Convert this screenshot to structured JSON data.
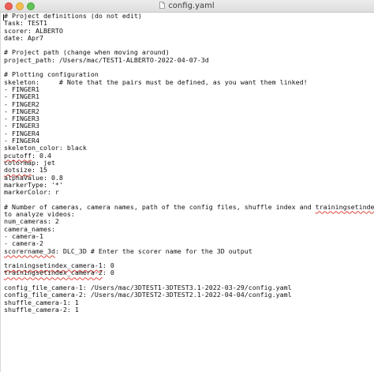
{
  "window": {
    "title": "config.yaml",
    "title_icon": "document-icon"
  },
  "editor": {
    "lines": [
      {
        "segments": [
          {
            "text": "# Project definitions (do not edit)"
          }
        ]
      },
      {
        "segments": [
          {
            "text": "Task: TEST1"
          }
        ]
      },
      {
        "segments": [
          {
            "text": "scorer: ALBERTO"
          }
        ]
      },
      {
        "segments": [
          {
            "text": "date: Apr7"
          }
        ]
      },
      {
        "segments": [
          {
            "text": ""
          }
        ]
      },
      {
        "segments": [
          {
            "text": "# Project path (change when moving around)"
          }
        ]
      },
      {
        "segments": [
          {
            "text": "project_path: /Users/mac/TEST1-ALBERTO-2022-04-07-3d"
          }
        ]
      },
      {
        "segments": [
          {
            "text": ""
          }
        ]
      },
      {
        "segments": [
          {
            "text": "# Plotting configuration"
          }
        ]
      },
      {
        "segments": [
          {
            "text": "skeleton:     # Note that the pairs must be defined, as you want them linked!"
          }
        ]
      },
      {
        "segments": [
          {
            "text": "- FINGER1"
          }
        ]
      },
      {
        "segments": [
          {
            "text": "- FINGER1"
          }
        ]
      },
      {
        "segments": [
          {
            "text": "- FINGER2"
          }
        ]
      },
      {
        "segments": [
          {
            "text": "- FINGER2"
          }
        ]
      },
      {
        "segments": [
          {
            "text": "- FINGER3"
          }
        ]
      },
      {
        "segments": [
          {
            "text": "- FINGER3"
          }
        ]
      },
      {
        "segments": [
          {
            "text": "- FINGER4"
          }
        ]
      },
      {
        "segments": [
          {
            "text": "- FINGER4"
          }
        ]
      },
      {
        "segments": [
          {
            "text": "skeleton_color: black"
          }
        ]
      },
      {
        "segments": [
          {
            "text": "pcutoff",
            "spell": true
          },
          {
            "text": ": 0.4"
          }
        ]
      },
      {
        "segments": [
          {
            "text": "colormap: jet"
          }
        ]
      },
      {
        "segments": [
          {
            "text": "dotsize",
            "spell": true
          },
          {
            "text": ": 15"
          }
        ]
      },
      {
        "segments": [
          {
            "text": "alphaValue: 0.8"
          }
        ]
      },
      {
        "segments": [
          {
            "text": "markerType: '*'"
          }
        ]
      },
      {
        "segments": [
          {
            "text": "markerColor: r"
          }
        ]
      },
      {
        "segments": [
          {
            "text": ""
          }
        ]
      },
      {
        "segments": [
          {
            "text": "# Number of cameras, camera names, path of the config files, shuffle index and "
          },
          {
            "text": "trainingsetindex",
            "spell": true
          },
          {
            "text": " used"
          }
        ]
      },
      {
        "segments": [
          {
            "text": "to analyze videos:"
          }
        ]
      },
      {
        "segments": [
          {
            "text": "num_cameras: 2"
          }
        ]
      },
      {
        "segments": [
          {
            "text": "camera_names:"
          }
        ]
      },
      {
        "segments": [
          {
            "text": "- camera-1"
          }
        ]
      },
      {
        "segments": [
          {
            "text": "- camera-2"
          }
        ]
      },
      {
        "segments": [
          {
            "text": "scorername_3d",
            "spell": true
          },
          {
            "text": ": DLC_3D # Enter the scorer name for the 3D output"
          }
        ]
      },
      {
        "segments": [
          {
            "text": ""
          }
        ]
      },
      {
        "segments": [
          {
            "text": "trainingsetindex_camera-1",
            "spell": true
          },
          {
            "text": ": 0"
          }
        ]
      },
      {
        "segments": [
          {
            "text": "trainingsetindex_camera-2",
            "spell": true
          },
          {
            "text": ": 0"
          }
        ]
      },
      {
        "segments": [
          {
            "text": ""
          }
        ]
      },
      {
        "segments": [
          {
            "text": "config_file_camera-1: /Users/mac/3DTEST1-3DTEST3.1-2022-03-29/config.yaml"
          }
        ]
      },
      {
        "segments": [
          {
            "text": "config_file_camera-2: /Users/mac/3DTEST2-3DTEST2.1-2022-04-04/config.yaml"
          }
        ]
      },
      {
        "segments": [
          {
            "text": "shuffle_camera-1: 1"
          }
        ]
      },
      {
        "segments": [
          {
            "text": "shuffle_camera-2: 1"
          }
        ]
      }
    ]
  }
}
